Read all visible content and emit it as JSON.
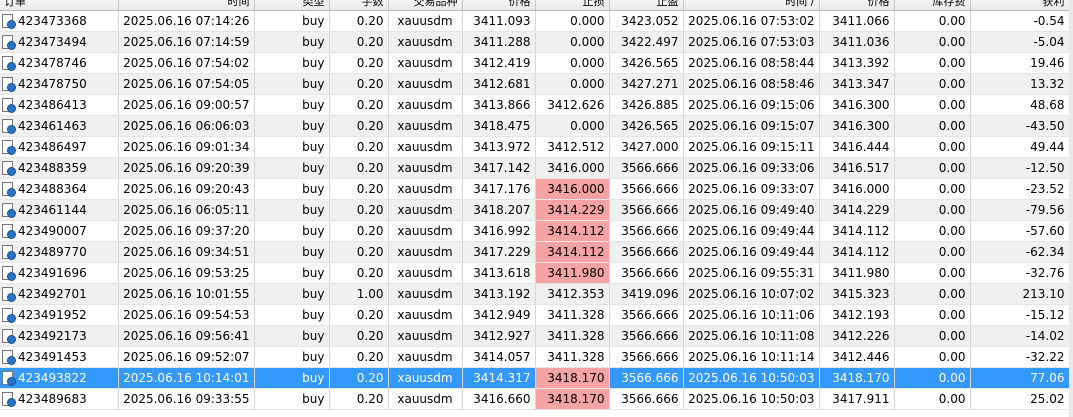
{
  "columns": [
    "订单",
    "时间",
    "类型",
    "手数",
    "交易品种",
    "价格",
    "止损",
    "止盈",
    "时间  /",
    "价格",
    "库存费",
    "获利"
  ],
  "rows": [
    {
      "order": "423473368",
      "open_time": "2025.06.16 07:14:26",
      "type": "buy",
      "volume": "0.20",
      "symbol": "xauusdm",
      "open_price": "3411.093",
      "sl": "0.000",
      "tp": "3423.052",
      "close_time": "2025.06.16 07:53:02",
      "close_price": "3411.066",
      "swap": "0.00",
      "profit": "-0.54",
      "sl_highlight": false,
      "selected": false
    },
    {
      "order": "423473494",
      "open_time": "2025.06.16 07:14:59",
      "type": "buy",
      "volume": "0.20",
      "symbol": "xauusdm",
      "open_price": "3411.288",
      "sl": "0.000",
      "tp": "3422.497",
      "close_time": "2025.06.16 07:53:03",
      "close_price": "3411.036",
      "swap": "0.00",
      "profit": "-5.04",
      "sl_highlight": false,
      "selected": false
    },
    {
      "order": "423478746",
      "open_time": "2025.06.16 07:54:02",
      "type": "buy",
      "volume": "0.20",
      "symbol": "xauusdm",
      "open_price": "3412.419",
      "sl": "0.000",
      "tp": "3426.565",
      "close_time": "2025.06.16 08:58:44",
      "close_price": "3413.392",
      "swap": "0.00",
      "profit": "19.46",
      "sl_highlight": false,
      "selected": false
    },
    {
      "order": "423478750",
      "open_time": "2025.06.16 07:54:05",
      "type": "buy",
      "volume": "0.20",
      "symbol": "xauusdm",
      "open_price": "3412.681",
      "sl": "0.000",
      "tp": "3427.271",
      "close_time": "2025.06.16 08:58:46",
      "close_price": "3413.347",
      "swap": "0.00",
      "profit": "13.32",
      "sl_highlight": false,
      "selected": false
    },
    {
      "order": "423486413",
      "open_time": "2025.06.16 09:00:57",
      "type": "buy",
      "volume": "0.20",
      "symbol": "xauusdm",
      "open_price": "3413.866",
      "sl": "3412.626",
      "tp": "3426.885",
      "close_time": "2025.06.16 09:15:06",
      "close_price": "3416.300",
      "swap": "0.00",
      "profit": "48.68",
      "sl_highlight": false,
      "selected": false
    },
    {
      "order": "423461463",
      "open_time": "2025.06.16 06:06:03",
      "type": "buy",
      "volume": "0.20",
      "symbol": "xauusdm",
      "open_price": "3418.475",
      "sl": "0.000",
      "tp": "3426.565",
      "close_time": "2025.06.16 09:15:07",
      "close_price": "3416.300",
      "swap": "0.00",
      "profit": "-43.50",
      "sl_highlight": false,
      "selected": false
    },
    {
      "order": "423486497",
      "open_time": "2025.06.16 09:01:34",
      "type": "buy",
      "volume": "0.20",
      "symbol": "xauusdm",
      "open_price": "3413.972",
      "sl": "3412.512",
      "tp": "3427.000",
      "close_time": "2025.06.16 09:15:11",
      "close_price": "3416.444",
      "swap": "0.00",
      "profit": "49.44",
      "sl_highlight": false,
      "selected": false
    },
    {
      "order": "423488359",
      "open_time": "2025.06.16 09:20:39",
      "type": "buy",
      "volume": "0.20",
      "symbol": "xauusdm",
      "open_price": "3417.142",
      "sl": "3416.000",
      "tp": "3566.666",
      "close_time": "2025.06.16 09:33:06",
      "close_price": "3416.517",
      "swap": "0.00",
      "profit": "-12.50",
      "sl_highlight": false,
      "selected": false
    },
    {
      "order": "423488364",
      "open_time": "2025.06.16 09:20:43",
      "type": "buy",
      "volume": "0.20",
      "symbol": "xauusdm",
      "open_price": "3417.176",
      "sl": "3416.000",
      "tp": "3566.666",
      "close_time": "2025.06.16 09:33:07",
      "close_price": "3416.000",
      "swap": "0.00",
      "profit": "-23.52",
      "sl_highlight": true,
      "selected": false
    },
    {
      "order": "423461144",
      "open_time": "2025.06.16 06:05:11",
      "type": "buy",
      "volume": "0.20",
      "symbol": "xauusdm",
      "open_price": "3418.207",
      "sl": "3414.229",
      "tp": "3566.666",
      "close_time": "2025.06.16 09:49:40",
      "close_price": "3414.229",
      "swap": "0.00",
      "profit": "-79.56",
      "sl_highlight": true,
      "selected": false
    },
    {
      "order": "423490007",
      "open_time": "2025.06.16 09:37:20",
      "type": "buy",
      "volume": "0.20",
      "symbol": "xauusdm",
      "open_price": "3416.992",
      "sl": "3414.112",
      "tp": "3566.666",
      "close_time": "2025.06.16 09:49:44",
      "close_price": "3414.112",
      "swap": "0.00",
      "profit": "-57.60",
      "sl_highlight": true,
      "selected": false
    },
    {
      "order": "423489770",
      "open_time": "2025.06.16 09:34:51",
      "type": "buy",
      "volume": "0.20",
      "symbol": "xauusdm",
      "open_price": "3417.229",
      "sl": "3414.112",
      "tp": "3566.666",
      "close_time": "2025.06.16 09:49:44",
      "close_price": "3414.112",
      "swap": "0.00",
      "profit": "-62.34",
      "sl_highlight": true,
      "selected": false
    },
    {
      "order": "423491696",
      "open_time": "2025.06.16 09:53:25",
      "type": "buy",
      "volume": "0.20",
      "symbol": "xauusdm",
      "open_price": "3413.618",
      "sl": "3411.980",
      "tp": "3566.666",
      "close_time": "2025.06.16 09:55:31",
      "close_price": "3411.980",
      "swap": "0.00",
      "profit": "-32.76",
      "sl_highlight": true,
      "selected": false
    },
    {
      "order": "423492701",
      "open_time": "2025.06.16 10:01:55",
      "type": "buy",
      "volume": "1.00",
      "symbol": "xauusdm",
      "open_price": "3413.192",
      "sl": "3412.353",
      "tp": "3419.096",
      "close_time": "2025.06.16 10:07:02",
      "close_price": "3415.323",
      "swap": "0.00",
      "profit": "213.10",
      "sl_highlight": false,
      "selected": false
    },
    {
      "order": "423491952",
      "open_time": "2025.06.16 09:54:53",
      "type": "buy",
      "volume": "0.20",
      "symbol": "xauusdm",
      "open_price": "3412.949",
      "sl": "3411.328",
      "tp": "3566.666",
      "close_time": "2025.06.16 10:11:06",
      "close_price": "3412.193",
      "swap": "0.00",
      "profit": "-15.12",
      "sl_highlight": false,
      "selected": false
    },
    {
      "order": "423492173",
      "open_time": "2025.06.16 09:56:41",
      "type": "buy",
      "volume": "0.20",
      "symbol": "xauusdm",
      "open_price": "3412.927",
      "sl": "3411.328",
      "tp": "3566.666",
      "close_time": "2025.06.16 10:11:08",
      "close_price": "3412.226",
      "swap": "0.00",
      "profit": "-14.02",
      "sl_highlight": false,
      "selected": false
    },
    {
      "order": "423491453",
      "open_time": "2025.06.16 09:52:07",
      "type": "buy",
      "volume": "0.20",
      "symbol": "xauusdm",
      "open_price": "3414.057",
      "sl": "3411.328",
      "tp": "3566.666",
      "close_time": "2025.06.16 10:11:14",
      "close_price": "3412.446",
      "swap": "0.00",
      "profit": "-32.22",
      "sl_highlight": false,
      "selected": false
    },
    {
      "order": "423493822",
      "open_time": "2025.06.16 10:14:01",
      "type": "buy",
      "volume": "0.20",
      "symbol": "xauusdm",
      "open_price": "3414.317",
      "sl": "3418.170",
      "tp": "3566.666",
      "close_time": "2025.06.16 10:50:03",
      "close_price": "3418.170",
      "swap": "0.00",
      "profit": "77.06",
      "sl_highlight": true,
      "selected": true
    },
    {
      "order": "423489683",
      "open_time": "2025.06.16 09:33:55",
      "type": "buy",
      "volume": "0.20",
      "symbol": "xauusdm",
      "open_price": "3416.660",
      "sl": "3418.170",
      "tp": "3566.666",
      "close_time": "2025.06.16 10:50:03",
      "close_price": "3417.911",
      "swap": "0.00",
      "profit": "25.02",
      "sl_highlight": true,
      "selected": false
    }
  ],
  "colors": {
    "alt_row": "#f0f0f0",
    "selected_row": "#3399ff",
    "sl_highlight": "#f7a3a3"
  },
  "icons": {
    "row_icon": "document-icon"
  }
}
